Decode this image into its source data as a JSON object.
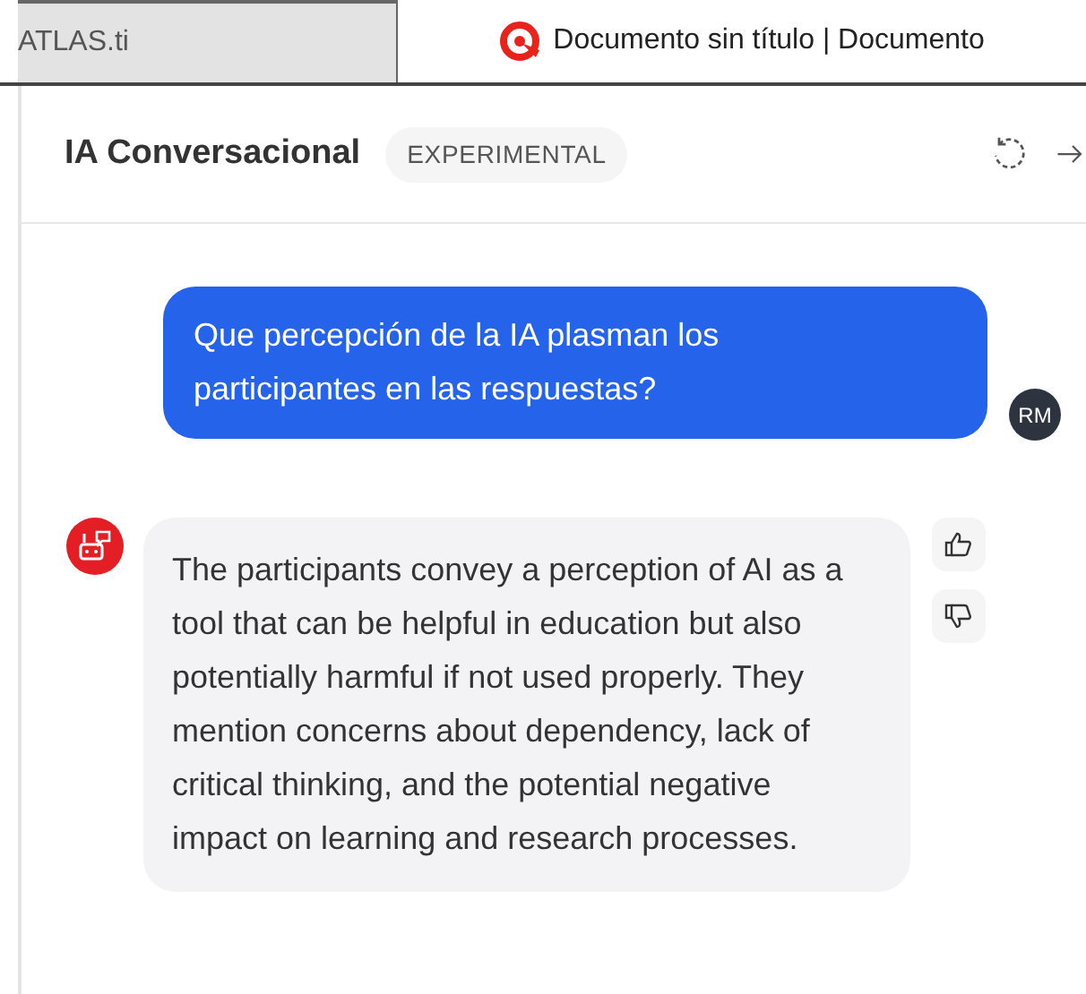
{
  "tabs": [
    {
      "label": "ATLAS.ti",
      "selected": false,
      "logo": false
    },
    {
      "label": "Documento sin título | Documento",
      "selected": true,
      "logo": true
    }
  ],
  "panel": {
    "title": "IA Conversacional",
    "badge": "EXPERIMENTAL"
  },
  "messages": [
    {
      "kind": "user",
      "text": "Que percepción de la IA plasman los participantes en las respuestas?",
      "avatar": "RM"
    },
    {
      "kind": "assistant",
      "text": "The participants convey a perception of AI as a tool that can be helpful in education but also potentially harmful if not used properly. They mention concerns about dependency, lack of critical thinking, and the potential negative impact on learning and research processes."
    }
  ]
}
